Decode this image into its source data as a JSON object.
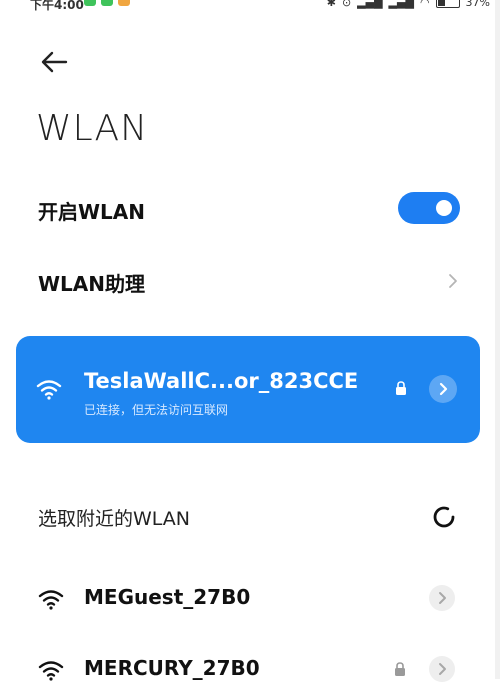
{
  "status_bar": {
    "time": "下午4:00",
    "dots": "···",
    "battery": "37%",
    "app_icon_colors": [
      "#3fc35b",
      "#3fc35b",
      "#f0a640"
    ]
  },
  "header": {
    "back_icon": "arrow-left-icon",
    "title": "WLAN"
  },
  "settings": {
    "enable_wlan_label": "开启WLAN",
    "enable_wlan_on": true,
    "assistant_label": "WLAN助理"
  },
  "connected_network": {
    "ssid": "TeslaWallC...or_823CCE",
    "status": "已连接，但无法访问互联网",
    "secured": true,
    "card_color": "#1f86f0"
  },
  "nearby": {
    "section_label": "选取附近的WLAN",
    "networks": [
      {
        "name": "MEGuest_27B0",
        "secured": false
      },
      {
        "name": "MERCURY_27B0",
        "secured": true
      }
    ]
  },
  "colors": {
    "accent": "#1e7ef2",
    "background": "#ffffff"
  }
}
